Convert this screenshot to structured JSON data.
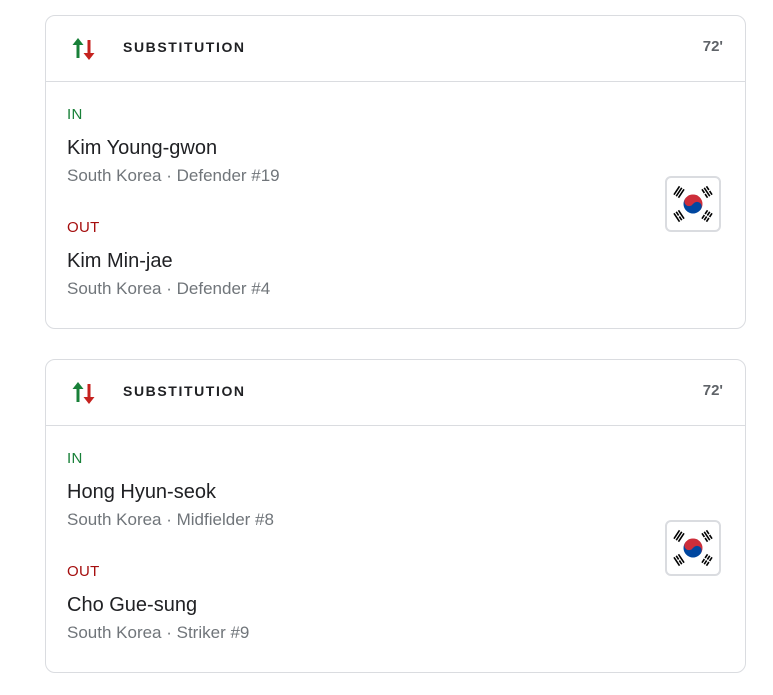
{
  "substitutions": [
    {
      "title": "SUBSTITUTION",
      "minute": "72'",
      "in": {
        "label": "IN",
        "name": "Kim Young-gwon",
        "meta": "South Korea · Defender #19"
      },
      "out": {
        "label": "OUT",
        "name": "Kim Min-jae",
        "meta": "South Korea · Defender #4"
      },
      "flag_icon": "south-korea-flag-icon"
    },
    {
      "title": "SUBSTITUTION",
      "minute": "72'",
      "in": {
        "label": "IN",
        "name": "Hong Hyun-seok",
        "meta": "South Korea · Midfielder #8"
      },
      "out": {
        "label": "OUT",
        "name": "Cho Gue-sung",
        "meta": "South Korea · Striker #9"
      },
      "flag_icon": "south-korea-flag-icon"
    }
  ],
  "colors": {
    "in": "#188038",
    "out": "#a50e0e",
    "border": "#dadce0",
    "text_primary": "#202124",
    "text_secondary": "#70757a"
  }
}
